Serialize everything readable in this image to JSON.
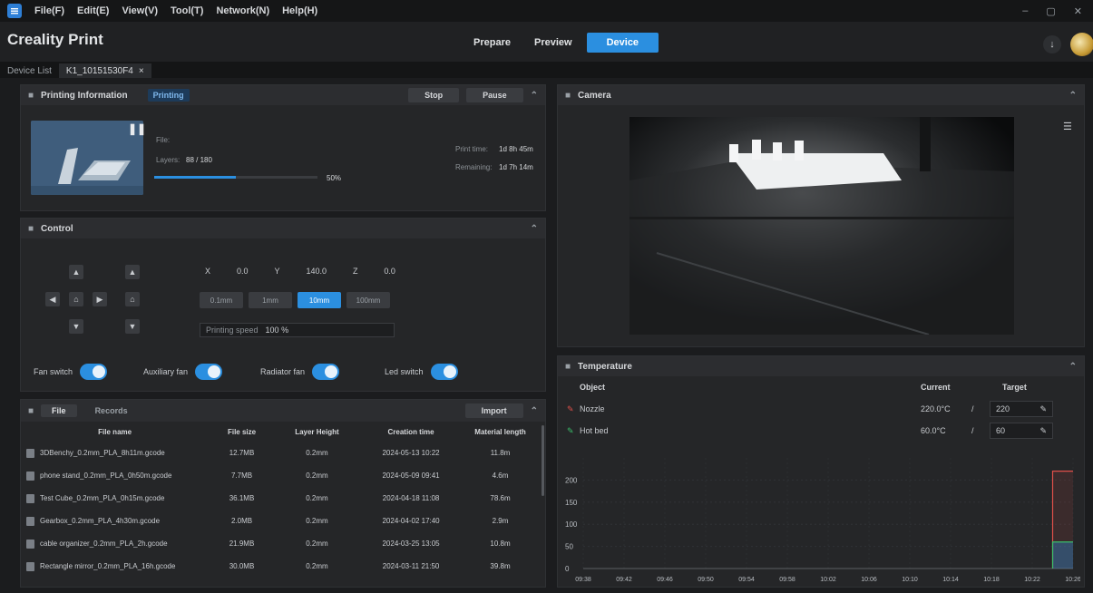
{
  "menu": {
    "items": [
      "File(F)",
      "Edit(E)",
      "View(V)",
      "Tool(T)",
      "Network(N)",
      "Help(H)"
    ]
  },
  "app": {
    "brand": "Creality Print"
  },
  "modes": {
    "prepare": "Prepare",
    "preview": "Preview",
    "device": "Device"
  },
  "doc_tabs": {
    "first": "Device List",
    "active": "K1_10151530F4"
  },
  "printing": {
    "title": "Printing Information",
    "status_chip": "Printing",
    "stop_btn": "Stop",
    "pause_btn": "Pause",
    "file_label": "File:",
    "layers_label": "Layers:",
    "layers_value": "88 / 180",
    "progress_text": "50%",
    "progress": 0.5,
    "print_time_label": "Print time:",
    "print_time_value": "1d 8h 45m",
    "remaining_label": "Remaining:",
    "remaining_value": "1d 7h 14m"
  },
  "control": {
    "title": "Control",
    "x_label": "X",
    "x_value": "0.0",
    "y_label": "Y",
    "y_value": "140.0",
    "z_label": "Z",
    "z_value": "0.0",
    "step_options": [
      "0.1mm",
      "1mm",
      "10mm",
      "100mm"
    ],
    "speed_label": "Printing speed",
    "speed_value": "100 %",
    "toggles": [
      {
        "label": "Fan switch"
      },
      {
        "label": "Auxiliary fan"
      },
      {
        "label": "Radiator fan"
      },
      {
        "label": "Led switch"
      }
    ]
  },
  "files": {
    "tab_local": "File",
    "tab_history": "Records",
    "import_btn": "Import",
    "headers": [
      "File name",
      "File size",
      "Layer Height",
      "Creation time",
      "Material length"
    ],
    "rows": [
      [
        "3DBenchy_0.2mm_PLA_8h11m.gcode",
        "12.7MB",
        "0.2mm",
        "2024-05-13 10:22",
        "11.8m"
      ],
      [
        "phone stand_0.2mm_PLA_0h50m.gcode",
        "7.7MB",
        "0.2mm",
        "2024-05-09 09:41",
        "4.6m"
      ],
      [
        "Test Cube_0.2mm_PLA_0h15m.gcode",
        "36.1MB",
        "0.2mm",
        "2024-04-18 11:08",
        "78.6m"
      ],
      [
        "Gearbox_0.2mm_PLA_4h30m.gcode",
        "2.0MB",
        "0.2mm",
        "2024-04-02 17:40",
        "2.9m"
      ],
      [
        "cable organizer_0.2mm_PLA_2h.gcode",
        "21.9MB",
        "0.2mm",
        "2024-03-25 13:05",
        "10.8m"
      ],
      [
        "Rectangle mirror_0.2mm_PLA_16h.gcode",
        "30.0MB",
        "0.2mm",
        "2024-03-11 21:50",
        "39.8m"
      ]
    ]
  },
  "camera": {
    "title": "Camera"
  },
  "temperature": {
    "title": "Temperature",
    "col_object": "Object",
    "col_current": "Current",
    "col_target": "Target",
    "rows": [
      {
        "name": "Nozzle",
        "current": "220.0°C",
        "sep": "/",
        "target": "220"
      },
      {
        "name": "Hot bed",
        "current": "60.0°C",
        "sep": "/",
        "target": "60"
      }
    ],
    "colors": {
      "nozzle": "#e0504a",
      "bed": "#3bbf6b",
      "accent": "#2b8fe0"
    }
  },
  "chart_data": {
    "type": "line",
    "title": "",
    "xlabel": "",
    "ylabel": "",
    "y_ticks": [
      "0",
      "50",
      "100",
      "150",
      "200"
    ],
    "x_ticks": [
      "09:38",
      "09:42",
      "09:46",
      "09:50",
      "09:54",
      "09:58",
      "10:02",
      "10:06",
      "10:10",
      "10:14",
      "10:18",
      "10:22",
      "10:26"
    ],
    "ylim": [
      0,
      250
    ],
    "series": [
      {
        "x": [
          "10:24",
          "10:24",
          "10:26"
        ],
        "values": [
          0,
          220,
          220
        ]
      },
      {
        "x": [
          "10:24",
          "10:24",
          "10:26"
        ],
        "values": [
          0,
          60,
          60
        ]
      }
    ]
  }
}
